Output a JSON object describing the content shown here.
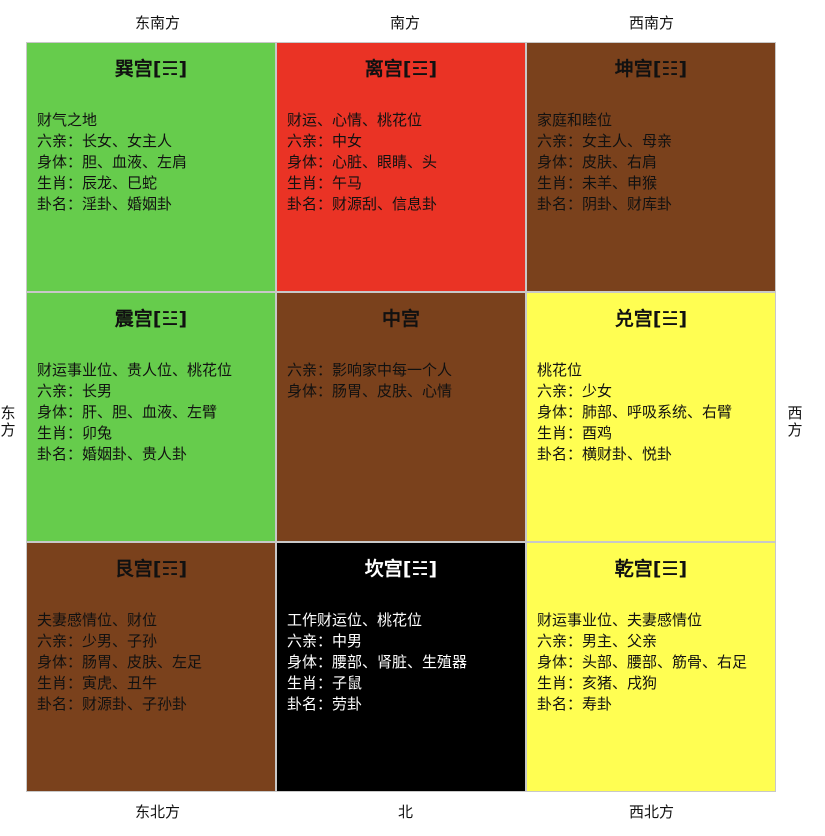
{
  "directions": {
    "top_left": "东南方",
    "top_center": "南方",
    "top_right": "西南方",
    "left": "东方",
    "right": "西方",
    "bottom_left": "东北方",
    "bottom_center": "北",
    "bottom_right": "西北方"
  },
  "palaces": [
    {
      "title": "巽宫[☴]",
      "bg": "#66cc4c",
      "text_color": "#111111",
      "lines": [
        "财气之地",
        "六亲：长女、女主人",
        "身体：胆、血液、左肩",
        "生肖：辰龙、巳蛇",
        "卦名：淫卦、婚姻卦"
      ]
    },
    {
      "title": "离宫[☲]",
      "bg": "#ea3325",
      "text_color": "#111111",
      "lines": [
        "财运、心情、桃花位",
        "六亲：中女",
        "身体：心脏、眼睛、头",
        "生肖：午马",
        "卦名：财源刮、信息卦"
      ]
    },
    {
      "title": "坤宫[☷]",
      "bg": "#7a411c",
      "text_color": "#111111",
      "lines": [
        "家庭和睦位",
        "六亲：女主人、母亲",
        "身体：皮肤、右肩",
        "生肖：未羊、申猴",
        "卦名：阴卦、财库卦"
      ]
    },
    {
      "title": "震宫[☳]",
      "bg": "#66cc4c",
      "text_color": "#111111",
      "lines": [
        "财运事业位、贵人位、桃花位",
        "六亲：长男",
        "身体：肝、胆、血液、左臂",
        "生肖：卯兔",
        "卦名：婚姻卦、贵人卦"
      ]
    },
    {
      "title": "中宫",
      "bg": "#7a411c",
      "text_color": "#111111",
      "lines": [
        "六亲：影响家中每一个人",
        "身体：肠胃、皮肤、心情"
      ]
    },
    {
      "title": "兑宫[☱]",
      "bg": "#fffe52",
      "text_color": "#111111",
      "lines": [
        "桃花位",
        "六亲：少女",
        "身体：肺部、呼吸系统、右臂",
        "生肖：酉鸡",
        "卦名：横财卦、悦卦"
      ]
    },
    {
      "title": "艮宫[☶]",
      "bg": "#7a411c",
      "text_color": "#111111",
      "lines": [
        "夫妻感情位、财位",
        "六亲：少男、子孙",
        "身体：肠胃、皮肤、左足",
        "生肖：寅虎、丑牛",
        "卦名：财源卦、子孙卦"
      ]
    },
    {
      "title": "坎宫[☵]",
      "bg": "#000000",
      "text_color": "#ffffff",
      "lines": [
        "工作财运位、桃花位",
        "六亲：中男",
        "身体：腰部、肾脏、生殖器",
        "生肖：子鼠",
        "卦名：劳卦"
      ]
    },
    {
      "title": "乾宫[☰]",
      "bg": "#fffe52",
      "text_color": "#111111",
      "lines": [
        "财运事业位、夫妻感情位",
        "六亲：男主、父亲",
        "身体：头部、腰部、筋骨、右足",
        "生肖：亥猪、戌狗",
        "卦名：寿卦"
      ]
    }
  ]
}
